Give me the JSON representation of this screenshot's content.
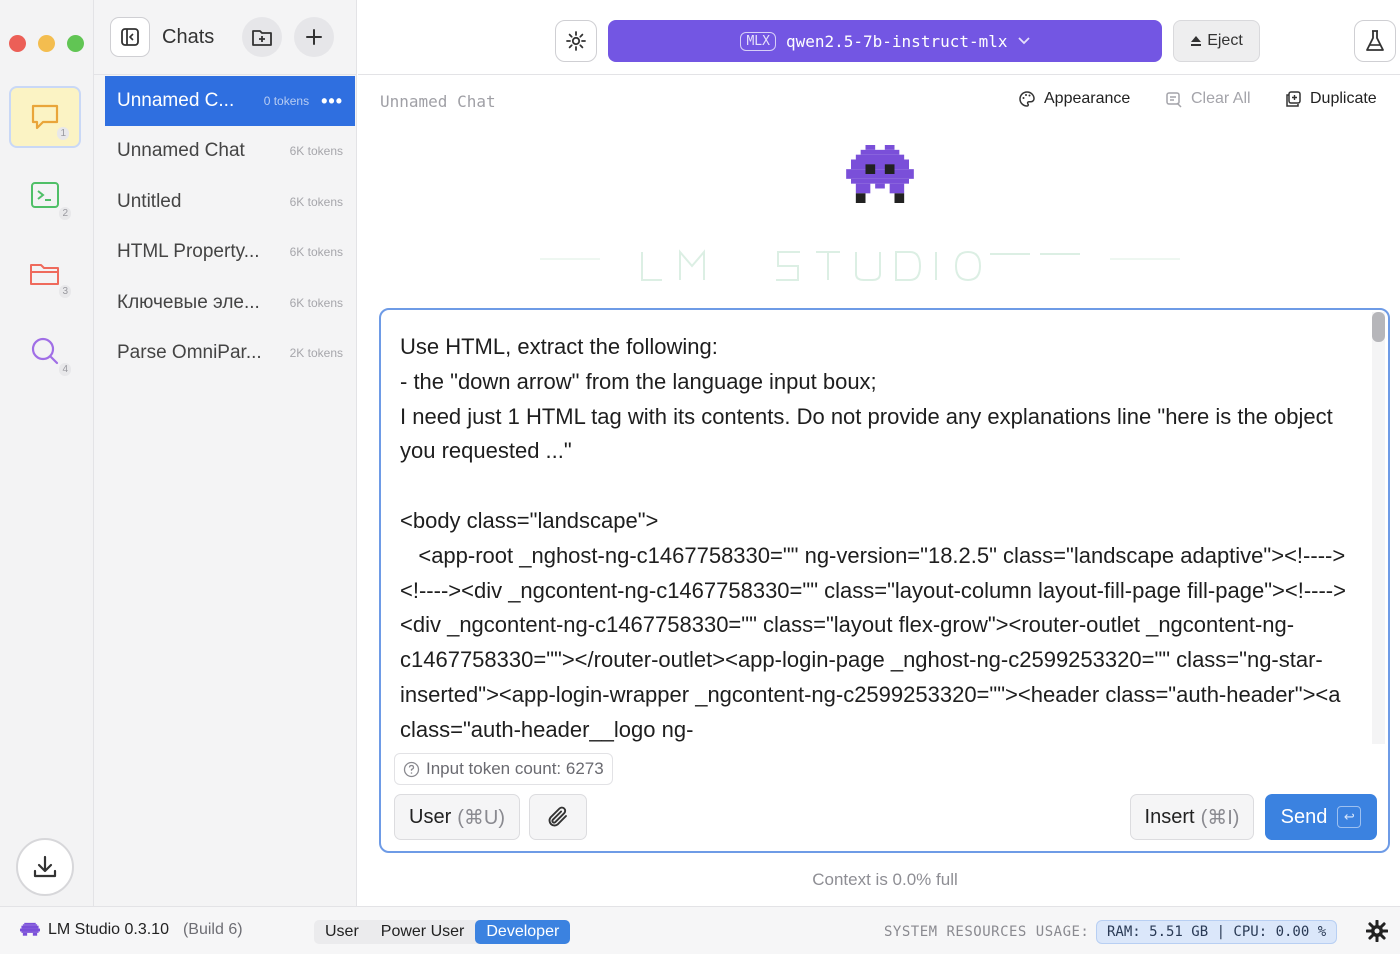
{
  "window": {
    "traffic_lights": [
      "#ec5f57",
      "#f3bd4f",
      "#61c554"
    ]
  },
  "rail": {
    "items": [
      {
        "icon": "chat-bubble-icon",
        "number": "1",
        "active": true
      },
      {
        "icon": "terminal-icon",
        "number": "2",
        "active": false
      },
      {
        "icon": "folder-icon",
        "number": "3",
        "active": false
      },
      {
        "icon": "search-icon",
        "number": "4",
        "active": false
      }
    ],
    "download_icon": "download-icon"
  },
  "chatlist": {
    "title": "Chats",
    "items": [
      {
        "name": "Unnamed C...",
        "tokens": "0 tokens",
        "active": true
      },
      {
        "name": "Unnamed Chat",
        "tokens": "6K tokens",
        "active": false
      },
      {
        "name": "Untitled",
        "tokens": "6K tokens",
        "active": false
      },
      {
        "name": "HTML Property...",
        "tokens": "6K tokens",
        "active": false
      },
      {
        "name": "Ключевые эле...",
        "tokens": "6K tokens",
        "active": false
      },
      {
        "name": "Parse OmniPar...",
        "tokens": "2K tokens",
        "active": false
      }
    ],
    "more_label": "•••"
  },
  "topbar": {
    "model_badge": "MLX",
    "model_name": "qwen2.5-7b-instruct-mlx",
    "eject_label": "Eject"
  },
  "subbar": {
    "chat_title": "Unnamed Chat",
    "appearance_label": "Appearance",
    "clear_all_label": "Clear All",
    "duplicate_label": "Duplicate"
  },
  "input": {
    "text": "Use HTML, extract the following:\n- the \"down arrow\" from the language input boux;\nI need just 1 HTML tag with its contents. Do not provide any explanations line \"here is the object you requested ...\"\n\n<body class=\"landscape\">\n   <app-root _nghost-ng-c1467758330=\"\" ng-version=\"18.2.5\" class=\"landscape adaptive\"><!----><!----><div _ngcontent-ng-c1467758330=\"\" class=\"layout-column layout-fill-page fill-page\"><!----><div _ngcontent-ng-c1467758330=\"\" class=\"layout flex-grow\"><router-outlet _ngcontent-ng-c1467758330=\"\"></router-outlet><app-login-page _nghost-ng-c2599253320=\"\" class=\"ng-star-inserted\"><app-login-wrapper _ngcontent-ng-c2599253320=\"\"><header class=\"auth-header\"><a class=\"auth-header__logo ng-",
    "token_count": "Input token count: 6273",
    "role_label": "User",
    "role_shortcut": "(⌘U)",
    "insert_label": "Insert",
    "insert_shortcut": "(⌘I)",
    "send_label": "Send",
    "send_key": "↩"
  },
  "context_text": "Context is 0.0% full",
  "status": {
    "app_name": "LM Studio 0.3.10",
    "build": "(Build 6)",
    "modes": [
      "User",
      "Power User",
      "Developer"
    ],
    "selected_mode": "Developer",
    "resources_label": "SYSTEM RESOURCES USAGE:",
    "resources_value": "RAM: 5.51 GB  |  CPU: 0.00 %"
  },
  "colors": {
    "accent": "#3b82e0",
    "model_purple": "#7356e3",
    "active_chat": "#2f6fe0"
  }
}
